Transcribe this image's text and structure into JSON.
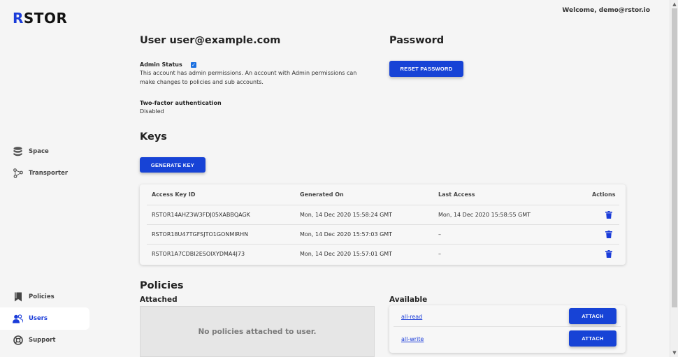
{
  "brand": {
    "logo_r": "R",
    "logo_rest": "STOR"
  },
  "header": {
    "welcome": "Welcome, demo@rstor.io"
  },
  "sidebar": {
    "items": [
      {
        "label": "Space",
        "icon": "database-icon"
      },
      {
        "label": "Transporter",
        "icon": "transporter-icon"
      },
      {
        "label": "Policies",
        "icon": "bookmark-icon"
      },
      {
        "label": "Users",
        "icon": "users-icon",
        "active": true
      },
      {
        "label": "Support",
        "icon": "support-icon"
      }
    ]
  },
  "user": {
    "title": "User user@example.com",
    "admin_label": "Admin Status",
    "admin_checked": true,
    "admin_desc": "This account has admin permissions. An account with Admin permissions can make changes to policies and sub accounts.",
    "tfa_label": "Two-factor authentication",
    "tfa_value": "Disabled"
  },
  "password": {
    "title": "Password",
    "reset_label": "RESET PASSWORD"
  },
  "keys": {
    "title": "Keys",
    "generate_label": "GENERATE KEY",
    "columns": [
      "Access Key ID",
      "Generated On",
      "Last Access",
      "Actions"
    ],
    "rows": [
      {
        "id": "RSTOR14AHZ3W3FDJ05XABBQAGK",
        "generated": "Mon, 14 Dec 2020 15:58:24 GMT",
        "last": "Mon, 14 Dec 2020 15:58:55 GMT"
      },
      {
        "id": "RSTOR18U47TGFSJTO1GONMIRHN",
        "generated": "Mon, 14 Dec 2020 15:57:03 GMT",
        "last": "–"
      },
      {
        "id": "RSTOR1A7CDBI2ESOIXYDMA4J73",
        "generated": "Mon, 14 Dec 2020 15:57:01 GMT",
        "last": "–"
      }
    ]
  },
  "policies": {
    "title": "Policies",
    "attached_title": "Attached",
    "attached_empty": "No policies attached to user.",
    "available_title": "Available",
    "available": [
      {
        "name": "all-read",
        "action": "ATTACH"
      },
      {
        "name": "all-write",
        "action": "ATTACH"
      }
    ]
  },
  "colors": {
    "accent": "#1743d6",
    "brand_r": "#1a3cd9"
  }
}
